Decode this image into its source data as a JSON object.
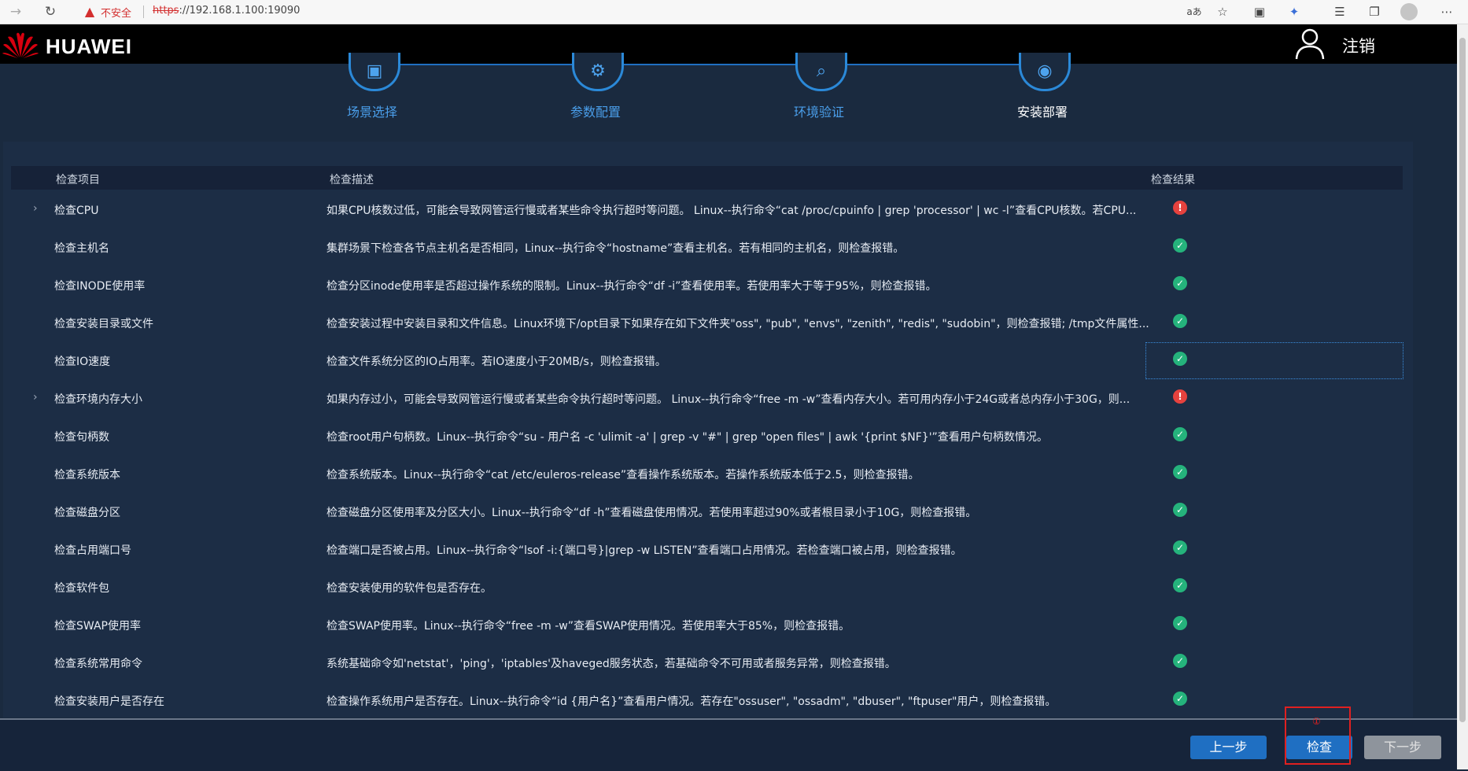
{
  "browser": {
    "security_label": "不安全",
    "url_scheme": "https",
    "url_rest": "://192.168.1.100:19090",
    "read_aloud": "aあ"
  },
  "header": {
    "brand": "HUAWEI",
    "logout": "注销"
  },
  "steps": [
    {
      "label": "场景选择",
      "state": "done"
    },
    {
      "label": "参数配置",
      "state": "done"
    },
    {
      "label": "环境验证",
      "state": "done"
    },
    {
      "label": "安装部署",
      "state": "active"
    }
  ],
  "table": {
    "headers": {
      "name": "检查项目",
      "desc": "检查描述",
      "result": "检查结果"
    },
    "rows": [
      {
        "expandable": true,
        "name": "检查CPU",
        "desc": "如果CPU核数过低，可能会导致网管运行慢或者某些命令执行超时等问题。 Linux--执行命令“cat /proc/cpuinfo | grep 'processor' | wc -l”查看CPU核数。若CPU...",
        "result": "error"
      },
      {
        "expandable": false,
        "name": "检查主机名",
        "desc": "集群场景下检查各节点主机名是否相同，Linux--执行命令“hostname”查看主机名。若有相同的主机名，则检查报错。",
        "result": "ok"
      },
      {
        "expandable": false,
        "name": "检查INODE使用率",
        "desc": "检查分区inode使用率是否超过操作系统的限制。Linux--执行命令“df -i”查看使用率。若使用率大于等于95%，则检查报错。",
        "result": "ok"
      },
      {
        "expandable": false,
        "name": "检查安装目录或文件",
        "desc": "检查安装过程中安装目录和文件信息。Linux环境下/opt目录下如果存在如下文件夹\"oss\", \"pub\", \"envs\", \"zenith\", \"redis\", \"sudobin\"，则检查报错; /tmp文件属性...",
        "result": "ok"
      },
      {
        "expandable": false,
        "name": "检查IO速度",
        "desc": "检查文件系统分区的IO占用率。若IO速度小于20MB/s，则检查报错。",
        "result": "ok"
      },
      {
        "expandable": true,
        "name": "检查环境内存大小",
        "desc": "如果内存过小，可能会导致网管运行慢或者某些命令执行超时等问题。 Linux--执行命令“free -m -w”查看内存大小。若可用内存小于24G或者总内存小于30G，则...",
        "result": "error"
      },
      {
        "expandable": false,
        "name": "检查句柄数",
        "desc": "检查root用户句柄数。Linux--执行命令“su - 用户名 -c 'ulimit -a' | grep -v \"#\" | grep \"open files\" | awk '{print $NF}'”查看用户句柄数情况。",
        "result": "ok"
      },
      {
        "expandable": false,
        "name": "检查系统版本",
        "desc": "检查系统版本。Linux--执行命令“cat /etc/euleros-release”查看操作系统版本。若操作系统版本低于2.5，则检查报错。",
        "result": "ok"
      },
      {
        "expandable": false,
        "name": "检查磁盘分区",
        "desc": "检查磁盘分区使用率及分区大小。Linux--执行命令“df -h”查看磁盘使用情况。若使用率超过90%或者根目录小于10G，则检查报错。",
        "result": "ok"
      },
      {
        "expandable": false,
        "name": "检查占用端口号",
        "desc": "检查端口是否被占用。Linux--执行命令“lsof -i:{端口号}|grep -w LISTEN”查看端口占用情况。若检查端口被占用，则检查报错。",
        "result": "ok"
      },
      {
        "expandable": false,
        "name": "检查软件包",
        "desc": "检查安装使用的软件包是否存在。",
        "result": "ok"
      },
      {
        "expandable": false,
        "name": "检查SWAP使用率",
        "desc": "检查SWAP使用率。Linux--执行命令“free -m -w”查看SWAP使用情况。若使用率大于85%，则检查报错。",
        "result": "ok"
      },
      {
        "expandable": false,
        "name": "检查系统常用命令",
        "desc": "系统基础命令如'netstat'，'ping'，'iptables'及haveged服务状态，若基础命令不可用或者服务异常，则检查报错。",
        "result": "ok"
      },
      {
        "expandable": false,
        "name": "检查安装用户是否存在",
        "desc": "检查操作系统用户是否存在。Linux--执行命令“id {用户名}”查看用户情况。若存在\"ossuser\", \"ossadm\", \"dbuser\", \"ftpuser\"用户，则检查报错。",
        "result": "ok"
      }
    ]
  },
  "footer": {
    "prev_label": "上一步",
    "check_label": "检查",
    "next_label": "下一步",
    "annotation": "①"
  },
  "colors": {
    "accent": "#1f6fc2",
    "ok": "#25b37c",
    "error": "#e6423e",
    "annotation": "#e02020"
  }
}
